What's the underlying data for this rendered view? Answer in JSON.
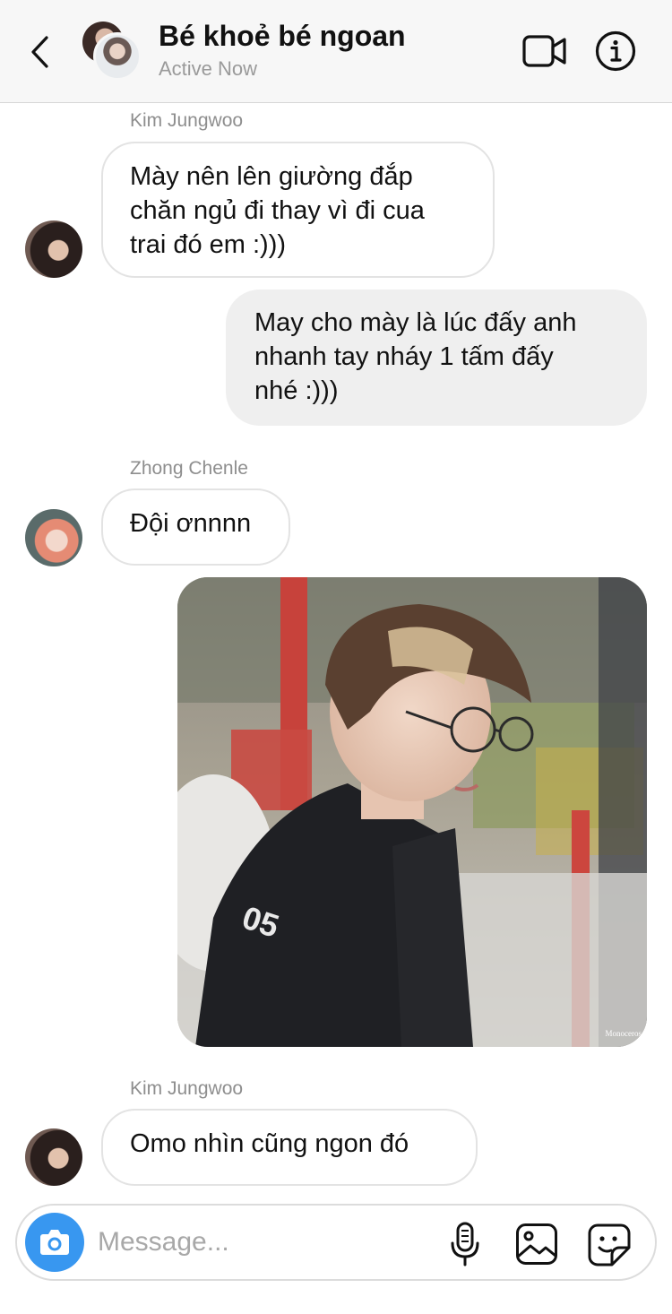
{
  "header": {
    "title": "Bé khoẻ bé ngoan",
    "status": "Active Now",
    "back_icon": "chevron-left-icon",
    "video_icon": "video-camera-icon",
    "info_icon": "info-icon"
  },
  "messages": [
    {
      "sender": "Kim Jungwoo",
      "direction": "incoming",
      "text": "Mày nên lên giường đắp\nchăn ngủ đi thay vì đi cua\ntrai đó em :)))"
    },
    {
      "direction": "outgoing",
      "text": "May cho mày là lúc đấy anh\nnhanh tay nháy 1 tấm đấy\nnhé :)))"
    },
    {
      "sender": "Zhong Chenle",
      "direction": "incoming",
      "text": "Đội ơnnnn"
    },
    {
      "direction": "outgoing",
      "type": "image",
      "watermark": "Monoceros"
    },
    {
      "sender": "Kim Jungwoo",
      "direction": "incoming",
      "text": "Omo nhìn cũng ngon đó"
    }
  ],
  "composer": {
    "placeholder": "Message...",
    "camera_icon": "camera-icon",
    "mic_icon": "microphone-icon",
    "gallery_icon": "gallery-icon",
    "sticker_icon": "sticker-icon"
  },
  "colors": {
    "accent": "#3897f0",
    "outgoing_bubble": "#efefef",
    "incoming_border": "#e3e3e3",
    "header_bg": "#f7f7f7"
  }
}
